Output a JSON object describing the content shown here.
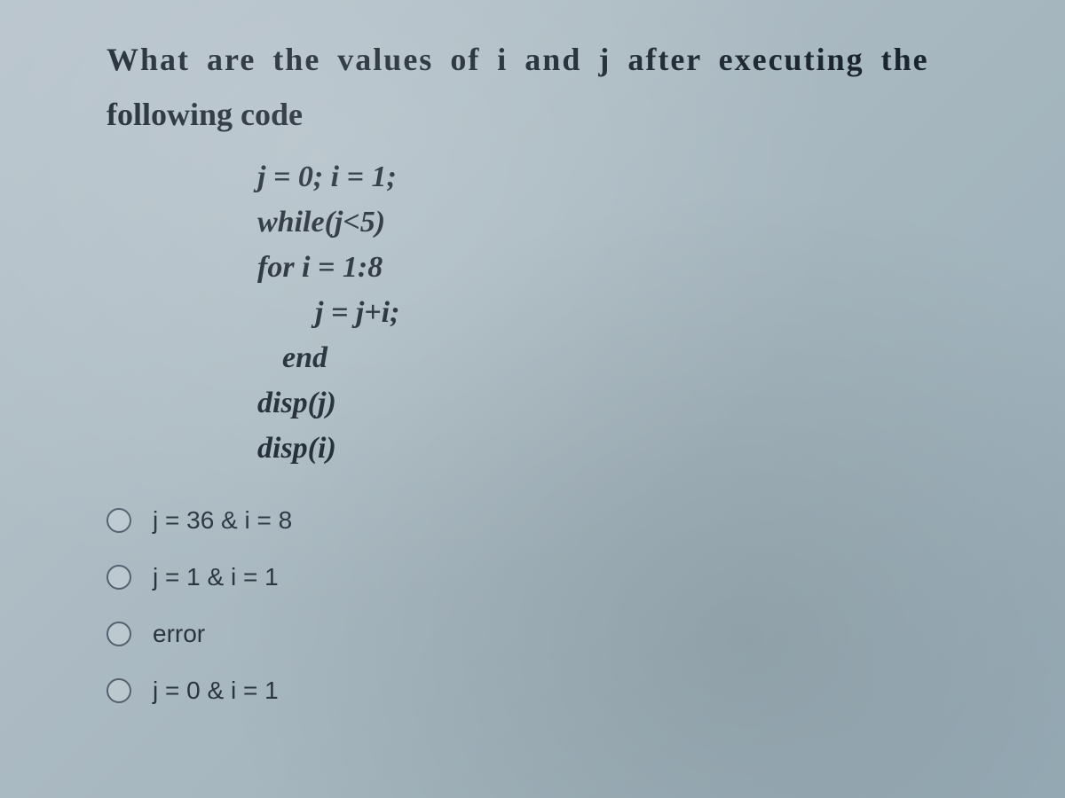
{
  "question": {
    "line1": "What are the values of i and j after executing the",
    "line2": "following code"
  },
  "code": {
    "line1": "j = 0; i = 1;",
    "line2": "while(j<5)",
    "line3": "for i = 1:8",
    "line4": "j = j+i;",
    "line5": "end",
    "line6": "disp(j)",
    "line7": "disp(i)"
  },
  "options": [
    {
      "label": "j = 36 & i = 8"
    },
    {
      "label": "j = 1 & i = 1"
    },
    {
      "label": "error"
    },
    {
      "label": "j = 0 & i = 1"
    }
  ]
}
